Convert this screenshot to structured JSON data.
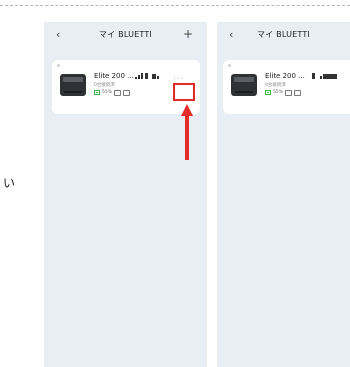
{
  "side_text": "い",
  "left_phone": {
    "title": "マイ BLUETTI",
    "back_icon": "‹",
    "plus_icon": "+",
    "device": {
      "name": "Elite 200 ...",
      "subtitle": "0台接続済",
      "battery_pct": "55%",
      "more": "···"
    }
  },
  "right_phone": {
    "title": "マイ BLUETTI",
    "back_icon": "‹",
    "device": {
      "name": "Elite 200 ...",
      "subtitle": "0台接続済",
      "battery_pct": "55%"
    }
  },
  "colors": {
    "highlight": "#e52a2a",
    "battery": "#3bb54a",
    "panel": "#e9eef5"
  },
  "icons": [
    "chevron-left-icon",
    "plus-icon",
    "more-dots-icon",
    "wifi-icon",
    "bluetooth-icon",
    "battery-icon",
    "ac-output-icon",
    "dc-output-icon",
    "arrow-up-icon"
  ]
}
